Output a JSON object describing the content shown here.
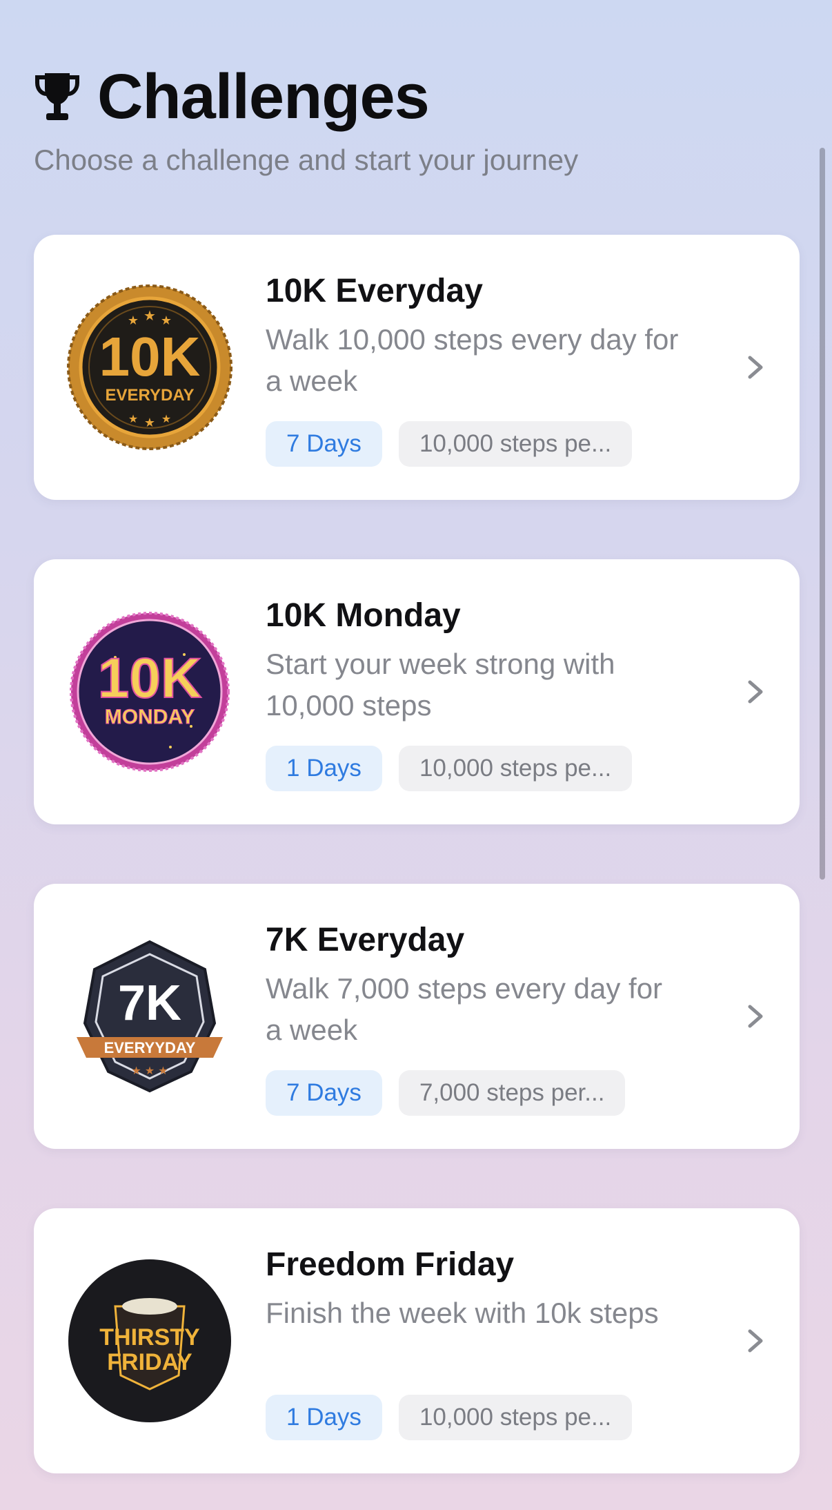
{
  "header": {
    "title": "Challenges",
    "subtitle": "Choose a challenge and start your journey",
    "icon": "trophy-icon"
  },
  "challenges": [
    {
      "title": "10K Everyday",
      "description": "Walk 10,000 steps every day for a week",
      "days_label": "7 Days",
      "steps_label": "10,000 steps pe...",
      "badge": {
        "line1": "10K",
        "line2": "EVERYDAY",
        "colors": {
          "main": "#1f1c18",
          "rim": "#c98a2c",
          "text": "#e7a53a"
        }
      }
    },
    {
      "title": "10K Monday",
      "description": "Start your week strong with 10,000 steps",
      "days_label": "1 Days",
      "steps_label": "10,000 steps pe...",
      "badge": {
        "line1": "10K",
        "line2": "MONDAY",
        "colors": {
          "main": "#231b4a",
          "rim": "#c23f9a",
          "text": "#f6cf5a"
        }
      }
    },
    {
      "title": "7K Everyday",
      "description": "Walk 7,000 steps every day for a week",
      "days_label": "7 Days",
      "steps_label": "7,000 steps per...",
      "badge": {
        "line1": "7K",
        "line2": "EVERYYDAY",
        "colors": {
          "main": "#2a2d3c",
          "rim": "#c8793a",
          "text": "#ffffff"
        }
      }
    },
    {
      "title": "Freedom Friday",
      "description": "Finish the week with 10k steps",
      "days_label": "1 Days",
      "steps_label": "10,000 steps pe...",
      "badge": {
        "line1": "THIRSTY",
        "line2": "FRIDAY",
        "colors": {
          "main": "#1a1a1e",
          "rim": "#1a1a1e",
          "text": "#f0b33a"
        }
      }
    }
  ],
  "colors": {
    "accent": "#2f7be0",
    "days_chip_bg": "#e5f0fc",
    "steps_chip_bg": "#f0f0f2"
  }
}
